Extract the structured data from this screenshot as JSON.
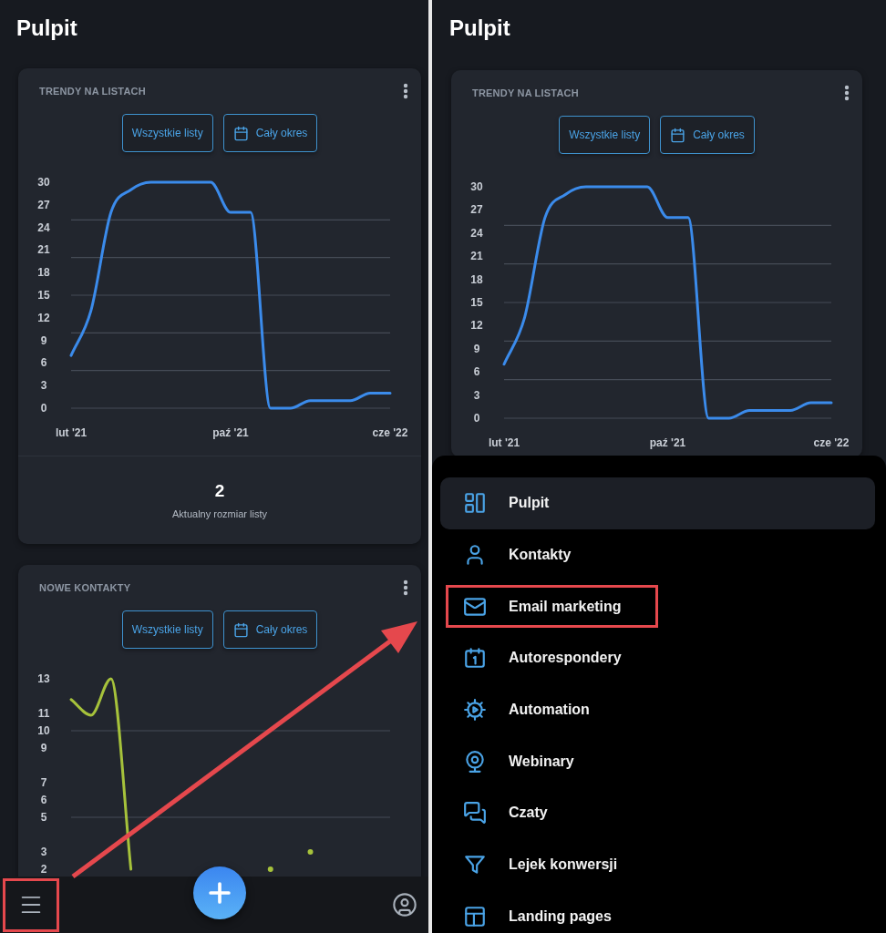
{
  "left_screen": {
    "title": "Pulpit",
    "cards": [
      {
        "title": "TRENDY NA LISTACH",
        "filters": [
          {
            "label": "Wszystkie listy",
            "kind": "list"
          },
          {
            "label": "Cały okres",
            "kind": "period"
          }
        ],
        "chart_data": {
          "type": "line",
          "categories": [
            "lut '21",
            null,
            null,
            null,
            null,
            null,
            null,
            null,
            "paź '21",
            null,
            null,
            null,
            null,
            null,
            null,
            null,
            "cze '22"
          ],
          "ylim": [
            0,
            30
          ],
          "yticks": [
            0,
            3,
            6,
            9,
            12,
            15,
            18,
            21,
            24,
            27,
            30
          ],
          "series": [
            {
              "color": "#3b8beb",
              "values": [
                7,
                13,
                26,
                29,
                30,
                30,
                30,
                30,
                26,
                26,
                0,
                0,
                1,
                1,
                1,
                2,
                2
              ]
            }
          ]
        },
        "footer": {
          "value": "2",
          "caption": "Aktualny rozmiar listy"
        }
      },
      {
        "title": "NOWE KONTAKTY",
        "filters": [
          {
            "label": "Wszystkie listy",
            "kind": "list"
          },
          {
            "label": "Cały okres",
            "kind": "period"
          }
        ],
        "chart_data": {
          "type": "line",
          "categories": [
            null,
            null,
            null,
            null,
            null,
            null,
            null,
            null,
            null,
            null,
            null,
            null,
            null,
            null,
            null,
            null,
            null
          ],
          "ylim": [
            2,
            13
          ],
          "yticks": [
            13,
            11,
            10,
            9,
            7,
            6,
            5,
            3,
            2
          ],
          "series": [
            {
              "color": "#a6c23b",
              "values": [
                11.8,
                10.9,
                13,
                2,
                null,
                null,
                null,
                null,
                null,
                null,
                2,
                null,
                3,
                null,
                null,
                null,
                null
              ]
            }
          ]
        }
      }
    ],
    "bottom_bar": {
      "menu_button": {
        "highlighted": true
      }
    }
  },
  "right_screen": {
    "title": "Pulpit",
    "cards": [
      {
        "title": "TRENDY NA LISTACH",
        "filters": [
          {
            "label": "Wszystkie listy",
            "kind": "list"
          },
          {
            "label": "Cały okres",
            "kind": "period"
          }
        ],
        "chart_data": {
          "type": "line",
          "categories": [
            "lut '21",
            null,
            null,
            null,
            null,
            null,
            null,
            null,
            "paź '21",
            null,
            null,
            null,
            null,
            null,
            null,
            null,
            "cze '22"
          ],
          "ylim": [
            0,
            30
          ],
          "yticks": [
            0,
            3,
            6,
            9,
            12,
            15,
            18,
            21,
            24,
            27,
            30
          ],
          "series": [
            {
              "color": "#3b8beb",
              "values": [
                7,
                13,
                26,
                29,
                30,
                30,
                30,
                30,
                26,
                26,
                0,
                0,
                1,
                1,
                1,
                2,
                2
              ]
            }
          ]
        }
      }
    ],
    "menu": {
      "items": [
        {
          "label": "Pulpit",
          "selected": true,
          "highlighted": false
        },
        {
          "label": "Kontakty",
          "selected": false,
          "highlighted": false
        },
        {
          "label": "Email marketing",
          "selected": false,
          "highlighted": true
        },
        {
          "label": "Autorespondery",
          "selected": false,
          "highlighted": false
        },
        {
          "label": "Automation",
          "selected": false,
          "highlighted": false
        },
        {
          "label": "Webinary",
          "selected": false,
          "highlighted": false
        },
        {
          "label": "Czaty",
          "selected": false,
          "highlighted": false
        },
        {
          "label": "Lejek konwersji",
          "selected": false,
          "highlighted": false
        },
        {
          "label": "Landing pages",
          "selected": false,
          "highlighted": false
        }
      ]
    }
  },
  "annotation_arrow": true
}
